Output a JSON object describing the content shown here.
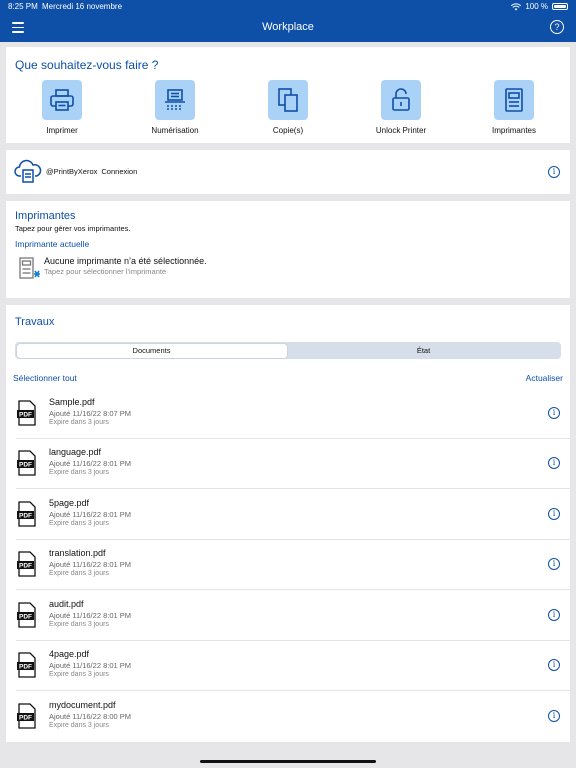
{
  "status": {
    "time": "8:25 PM",
    "date": "Mercredi 16 novembre",
    "battery": "100 %"
  },
  "nav": {
    "title": "Workplace"
  },
  "actions": {
    "question": "Que souhaitez-vous faire ?",
    "items": [
      {
        "label": "Imprimer",
        "icon": "printer-icon"
      },
      {
        "label": "Numérisation",
        "icon": "scanner-icon"
      },
      {
        "label": "Copie(s)",
        "icon": "copy-icon"
      },
      {
        "label": "Unlock Printer",
        "icon": "unlock-icon"
      },
      {
        "label": "Imprimantes",
        "icon": "multifunction-printer-icon"
      }
    ]
  },
  "cloud": {
    "handle": "@PrintByXerox",
    "action": "Connexion"
  },
  "printers": {
    "title": "Imprimantes",
    "subtitle": "Tapez pour gérer vos imprimantes.",
    "current_label": "Imprimante actuelle",
    "none_selected": "Aucune imprimante n’a été sélectionnée.",
    "tap_hint": "Tapez pour sélectionner l’imprimante"
  },
  "jobs": {
    "title": "Travaux",
    "tabs": [
      "Documents",
      "État"
    ],
    "select_all": "Sélectionner tout",
    "refresh": "Actualiser",
    "items": [
      {
        "name": "Sample.pdf",
        "added": "Ajouté 11/16/22 8:07 PM",
        "expires": "Expire dans 3 jours"
      },
      {
        "name": "language.pdf",
        "added": "Ajouté 11/16/22 8:01 PM",
        "expires": "Expire dans 3 jours"
      },
      {
        "name": "5page.pdf",
        "added": "Ajouté 11/16/22 8:01 PM",
        "expires": "Expire dans 3 jours"
      },
      {
        "name": "translation.pdf",
        "added": "Ajouté 11/16/22 8:01 PM",
        "expires": "Expire dans 3 jours"
      },
      {
        "name": "audit.pdf",
        "added": "Ajouté 11/16/22 8:01 PM",
        "expires": "Expire dans 3 jours"
      },
      {
        "name": "4page.pdf",
        "added": "Ajouté 11/16/22 8:01 PM",
        "expires": "Expire dans 3 jours"
      },
      {
        "name": "mydocument.pdf",
        "added": "Ajouté 11/16/22 8:00 PM",
        "expires": "Expire dans 3 jours"
      }
    ]
  },
  "colors": {
    "primary": "#0e4fa8",
    "tile": "#aad2f7",
    "background": "#e6e6e8"
  }
}
